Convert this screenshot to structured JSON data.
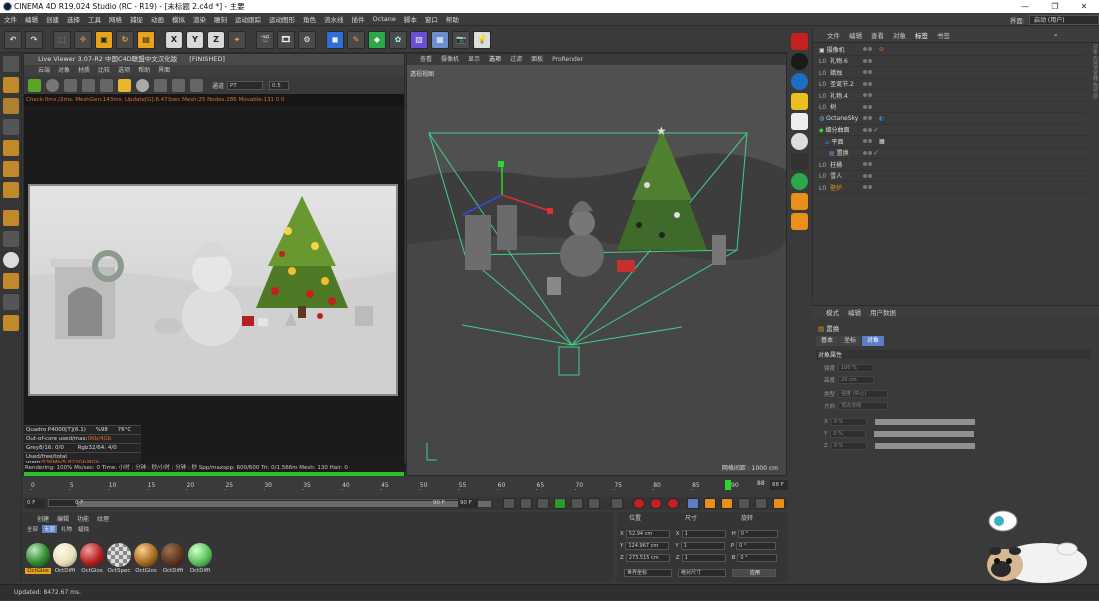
{
  "window": {
    "title": "CINEMA 4D R19.024 Studio (RC - R19) - [未标题 2.c4d *] - 主要",
    "controls": [
      "—",
      "❐",
      "✕"
    ]
  },
  "menubar": {
    "items": [
      "文件",
      "编辑",
      "创建",
      "选择",
      "工具",
      "网格",
      "捕捉",
      "动画",
      "模拟",
      "渲染",
      "雕刻",
      "运动跟踪",
      "运动图形",
      "角色",
      "流水线",
      "插件",
      "Octane",
      "脚本",
      "窗口",
      "帮助"
    ]
  },
  "layout": {
    "label": "界面:",
    "value": "启动 (用户)"
  },
  "toolbar": {
    "xyz": [
      "X",
      "Y",
      "Z"
    ]
  },
  "live_viewer": {
    "title": "Live Viewer 3.07-R2 中国C4D联盟中文汉化版",
    "state": "[FINISHED]",
    "menu": [
      "云端",
      "对象",
      "材质",
      "比较",
      "选项",
      "帮助",
      "界面"
    ],
    "channel_label": "通道",
    "channel_value": "PT",
    "zoom": "0.5",
    "stats_line": "Check:0ms./2ms. MeshGen:143ms. Update[G]:8.473sec Mesh:25 Nodes:286 Movable:131  0 0",
    "hud": [
      {
        "a": "Quadro P4000[T](6.1)",
        "b": "%98",
        "c": "76°C"
      },
      {
        "a": "Out-of-core used/max:",
        "b": "0Kb/4Gb",
        "c": ""
      },
      {
        "a": "Grey8/16: 0/0",
        "b": "Rgb32/64: 4/0",
        "c": ""
      },
      {
        "a": "Used/free/total vram:",
        "b": "536Mb/5.822Gb/8Gb",
        "c": ""
      }
    ],
    "render_status": "Rendering: 100%   Ms/sec: 0   Time: 小时 : 分钟 : 秒/小时 : 分钟 : 秒   Spp/maxspp: 600/600   Tri: 0/1.566m  Mesh: 130  Hair: 0",
    "progress": 1.0
  },
  "viewport": {
    "menu": [
      "查看",
      "摄像机",
      "显示",
      "选项",
      "过滤",
      "面板",
      "ProRender"
    ],
    "title": "透视视图",
    "grid_scale": "网格间距 : 1000 cm"
  },
  "object_manager": {
    "menu": [
      "文件",
      "编辑",
      "查看",
      "对象",
      "标签",
      "书签"
    ],
    "objects": [
      {
        "name": "摄像机",
        "prefix": "",
        "status": "check"
      },
      {
        "name": "礼物.6",
        "prefix": "L0",
        "status": "check"
      },
      {
        "name": "蜡烛",
        "prefix": "L0",
        "status": "check"
      },
      {
        "name": "圣诞节.2",
        "prefix": "L0",
        "status": "check"
      },
      {
        "name": "礼物.4",
        "prefix": "L0",
        "status": "check"
      },
      {
        "name": "树",
        "prefix": "L0",
        "status": "check"
      },
      {
        "name": "OctaneSky",
        "prefix": "",
        "status": "check"
      },
      {
        "name": "细分曲面",
        "prefix": "",
        "status": "check"
      },
      {
        "name": "平面",
        "prefix": "",
        "status": "check"
      },
      {
        "name": "置换",
        "prefix": "",
        "status": "check"
      },
      {
        "name": "柱桶",
        "prefix": "L0",
        "status": "check"
      },
      {
        "name": "雪人",
        "prefix": "L0",
        "status": "check"
      },
      {
        "name": "壁炉",
        "prefix": "L0",
        "status": "check"
      }
    ],
    "side_tabs": "对象 内容浏览器 构造 层"
  },
  "attribute_manager": {
    "menu": [
      "模式",
      "编辑",
      "用户数据"
    ],
    "object_name": "置换",
    "tabs": [
      "基本",
      "坐标",
      "对象"
    ],
    "active_tab": "对象",
    "section": "对象属性",
    "rows": [
      {
        "label": "强度",
        "value": "100 %"
      },
      {
        "label": "高度",
        "value": "20 cm"
      },
      {
        "label": "类型",
        "value": "强度 (中心)"
      },
      {
        "label": "方向",
        "value": "顶点法线"
      },
      {
        "label": "X",
        "value": "0 %"
      },
      {
        "label": "Y",
        "value": "0 %"
      },
      {
        "label": "Z",
        "value": "0 %"
      }
    ]
  },
  "timeline": {
    "ticks": [
      "0",
      "5",
      "10",
      "15",
      "20",
      "25",
      "30",
      "35",
      "40",
      "45",
      "50",
      "55",
      "60",
      "65",
      "70",
      "75",
      "80",
      "85",
      "90"
    ],
    "current": "88",
    "current_box": "88 F"
  },
  "playback": {
    "start": "0 F",
    "range_start": "0 F",
    "range_end": "90 F",
    "end": "90 F"
  },
  "material_manager": {
    "menu": [
      "创建",
      "编辑",
      "功能",
      "纹理"
    ],
    "filters": [
      "全部",
      "无层",
      "礼物",
      "蜡烛"
    ],
    "active_filter": "无层",
    "materials": [
      {
        "name": "OctGlos",
        "color": "#2e8a2e"
      },
      {
        "name": "OctDiffi",
        "color": "#e8e0b8"
      },
      {
        "name": "OctGlos",
        "color": "#b52020"
      },
      {
        "name": "OctSpec",
        "color": "#c8c8c8"
      },
      {
        "name": "OctGlos",
        "color": "#a86a20"
      },
      {
        "name": "OctDiffi",
        "color": "#5a3520"
      },
      {
        "name": "OctDiffi",
        "color": "#5cc05c"
      }
    ]
  },
  "coordinates": {
    "headers": [
      "位置",
      "尺寸",
      "旋转"
    ],
    "rows": [
      {
        "axis": "X",
        "pos": "52.94 cm",
        "size_axis": "X",
        "size": "1",
        "rot_axis": "H",
        "rot": "0 °"
      },
      {
        "axis": "Y",
        "pos": "124.967 cm",
        "size_axis": "Y",
        "size": "1",
        "rot_axis": "P",
        "rot": "0 °"
      },
      {
        "axis": "Z",
        "pos": "273.515 cm",
        "size_axis": "Z",
        "size": "1",
        "rot_axis": "B",
        "rot": "0 °"
      }
    ],
    "mode_1": "世界坐标",
    "mode_2": "绝对尺寸",
    "apply": "应用"
  },
  "status": {
    "text": "Updated: 8472.67 ms."
  }
}
